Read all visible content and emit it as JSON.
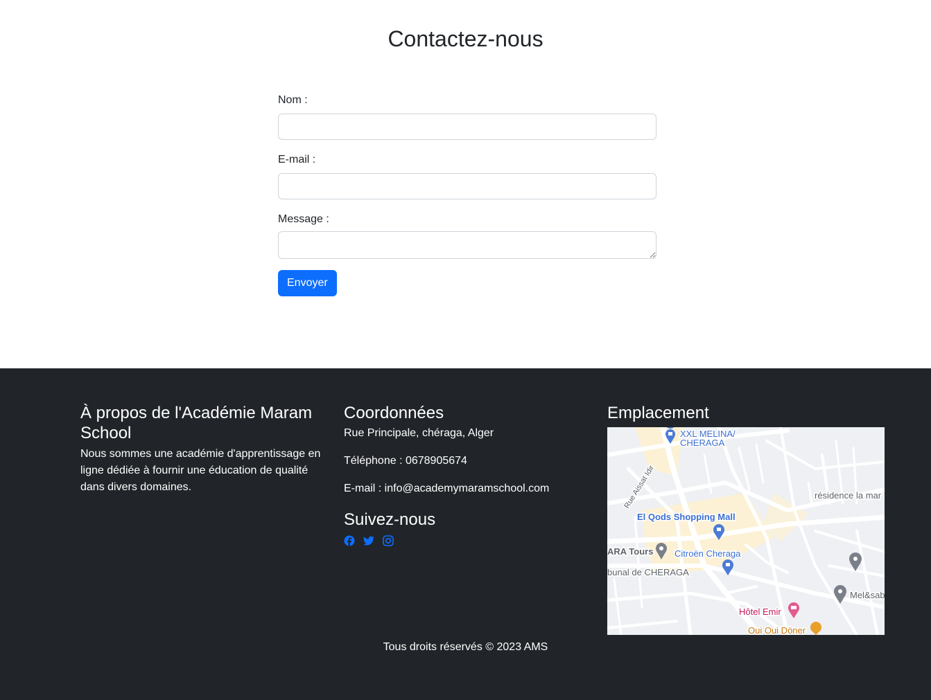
{
  "contact": {
    "title": "Contactez-nous",
    "name_label": "Nom :",
    "name_value": "",
    "email_label": "E-mail :",
    "email_value": "",
    "message_label": "Message :",
    "message_value": "",
    "submit_label": "Envoyer"
  },
  "footer": {
    "about": {
      "title": "À propos de l'Académie Maram School",
      "text": "Nous sommes une académie d'apprentissage en ligne dédiée à fournir une éducation de qualité dans divers domaines."
    },
    "coords": {
      "title": "Coordonnées",
      "address": "Rue Principale, chéraga, Alger",
      "phone": "Téléphone : 0678905674",
      "email": "E-mail : info@academymaramschool.com"
    },
    "follow": {
      "title": "Suivez-nous",
      "icons": [
        "facebook-icon",
        "twitter-icon",
        "instagram-icon"
      ],
      "icon_color": "#0d6efd"
    },
    "location": {
      "title": "Emplacement",
      "map_labels": {
        "xxl_line1": "XXL MELINA/",
        "xxl_line2": "CHERAGA",
        "street": "Rue Aissat Idir",
        "residence": "résidence la mar",
        "qods": "El Qods Shopping Mall",
        "tours": "ARA Tours",
        "citroen": "Citroën Cheraga",
        "tribunal": "bunal de CHERAGA",
        "melsab": "Mel&sab",
        "hotel": "Hôtel Emir",
        "doner": "Oui Oui Döner"
      }
    },
    "copyright": "Tous droits réservés © 2023 AMS"
  },
  "colors": {
    "primary": "#0d6efd",
    "footer_bg": "#212529"
  }
}
